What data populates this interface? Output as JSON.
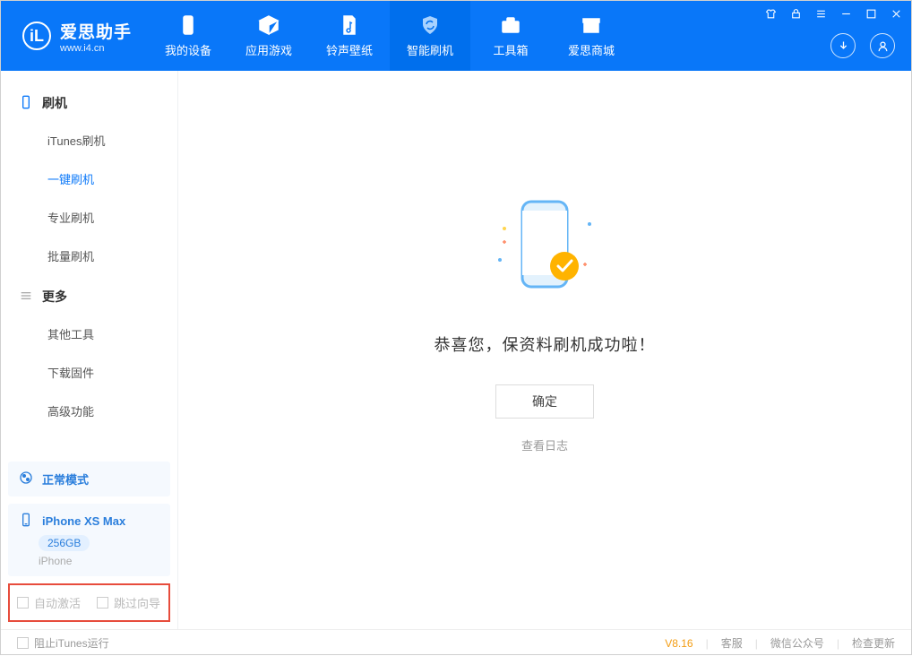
{
  "app": {
    "title": "爱思助手",
    "subtitle": "www.i4.cn"
  },
  "nav": {
    "items": [
      {
        "label": "我的设备"
      },
      {
        "label": "应用游戏"
      },
      {
        "label": "铃声壁纸"
      },
      {
        "label": "智能刷机"
      },
      {
        "label": "工具箱"
      },
      {
        "label": "爱思商城"
      }
    ]
  },
  "sidebar": {
    "group1": {
      "title": "刷机",
      "items": [
        "iTunes刷机",
        "一键刷机",
        "专业刷机",
        "批量刷机"
      ]
    },
    "group2": {
      "title": "更多",
      "items": [
        "其他工具",
        "下载固件",
        "高级功能"
      ]
    },
    "mode": "正常模式",
    "device": {
      "name": "iPhone XS Max",
      "storage": "256GB",
      "type": "iPhone"
    },
    "opts": {
      "auto_activate": "自动激活",
      "skip_guide": "跳过向导"
    }
  },
  "main": {
    "success": "恭喜您，保资料刷机成功啦！",
    "ok": "确定",
    "view_log": "查看日志"
  },
  "footer": {
    "block_itunes": "阻止iTunes运行",
    "version": "V8.16",
    "support": "客服",
    "wechat": "微信公众号",
    "update": "检查更新"
  }
}
